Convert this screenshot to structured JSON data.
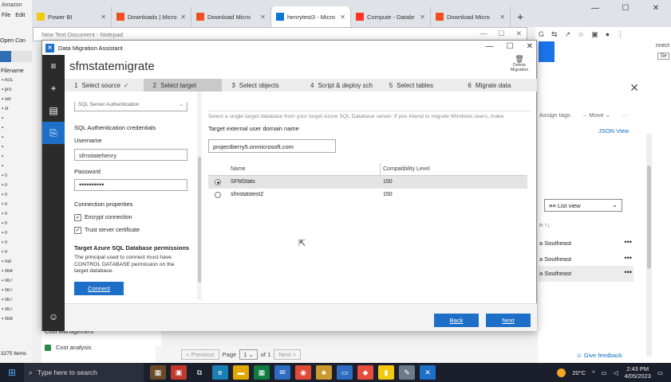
{
  "explorer": {
    "title": "Amazon",
    "menu": [
      "File",
      "Edit"
    ],
    "open_conn": "Open Con",
    "filename_label": "Filename",
    "tree_items": [
      "A01",
      "pro",
      "ser",
      "sf",
      "",
      "",
      "",
      "",
      "",
      "",
      "0",
      "0",
      "0",
      "0",
      "0",
      "0",
      "0",
      "0",
      "0",
      "0af",
      "0b4",
      "0b7",
      "0b7",
      "0b7",
      "0b7",
      "0b8"
    ],
    "count": "3275 Items"
  },
  "browser": {
    "tabs": [
      {
        "label": "Power BI",
        "icon": "powerbi-icon",
        "color": "#f2c811"
      },
      {
        "label": "Downloads | Micro",
        "icon": "microsoft-icon",
        "color": "#f25022"
      },
      {
        "label": "Download Micro",
        "icon": "microsoft-icon",
        "color": "#f25022"
      },
      {
        "label": "henrytest3 - Micro",
        "icon": "azure-icon",
        "color": "#0078d4",
        "active": true
      },
      {
        "label": "Compute - Databr",
        "icon": "databricks-icon",
        "color": "#ff3621"
      },
      {
        "label": "Download Micro",
        "icon": "microsoft-icon",
        "color": "#f25022"
      }
    ],
    "new_tab": "+",
    "addr_icons": [
      "G",
      "⇆",
      "↗",
      "☆",
      "▣",
      "●",
      "⋮"
    ],
    "partial_connect": "nnect",
    "partial_se": "Se",
    "panel": {
      "assign_tags": "Assign tags",
      "move": "Move",
      "json_view": "JSON View",
      "list_view": "List view",
      "rows": [
        "a Southeast",
        "a Southeast",
        "a Southeast"
      ],
      "give_feedback": "Give feedback"
    },
    "pager": {
      "previous": "< Previous",
      "page": "Page",
      "page_value": "1",
      "of": "of 1",
      "next": "Next >"
    },
    "cost": {
      "heading": "Cost Management",
      "analysis": "Cost analysis"
    }
  },
  "notepad": {
    "title": "New Text Document - Notepad"
  },
  "dma": {
    "window_title": "Data Migration Assistant",
    "project_name": "sfmstatemigrate",
    "delete_label_1": "Delete",
    "delete_label_2": "Migration",
    "steps": [
      {
        "num": "1",
        "label": "Select source",
        "done": true
      },
      {
        "num": "2",
        "label": "Select target",
        "active": true
      },
      {
        "num": "3",
        "label": "Select objects"
      },
      {
        "num": "4",
        "label": "Script & deploy sch"
      },
      {
        "num": "5",
        "label": "Select tables"
      },
      {
        "num": "6",
        "label": "Migrate data"
      }
    ],
    "auth": {
      "auth_type": "SQL Server Authentication",
      "creds_heading": "SQL Authentication credentials",
      "username_label": "Username",
      "username_value": "sfmstatehenry",
      "password_label": "Password",
      "password_value": "••••••••••",
      "conn_props": "Connection properties",
      "encrypt": "Encrypt connection",
      "trust": "Trust server certificate",
      "perm_heading": "Target Azure SQL Database permissions",
      "perm_desc": "The principal used to connect must have CONTROL DATABASE permission on the target database.",
      "connect": "Connect"
    },
    "target": {
      "intro": "Select a single target database from your target Azure SQL Database server. If you intend to migrate Windows users, make",
      "domain_label": "Target external user domain name",
      "domain_value": "projectberry5.onmicrosoft.com",
      "col_name": "Name",
      "col_compat": "Compatibility Level",
      "rows": [
        {
          "name": "SFMStats",
          "compat": "150",
          "selected": true
        },
        {
          "name": "sfmstatstest2",
          "compat": "150",
          "selected": false
        }
      ]
    },
    "back": "Back",
    "next": "Next"
  },
  "taskbar": {
    "search_placeholder": "Type here to search",
    "temperature": "20°C",
    "time": "2:43 PM",
    "date": "4/05/2023"
  }
}
